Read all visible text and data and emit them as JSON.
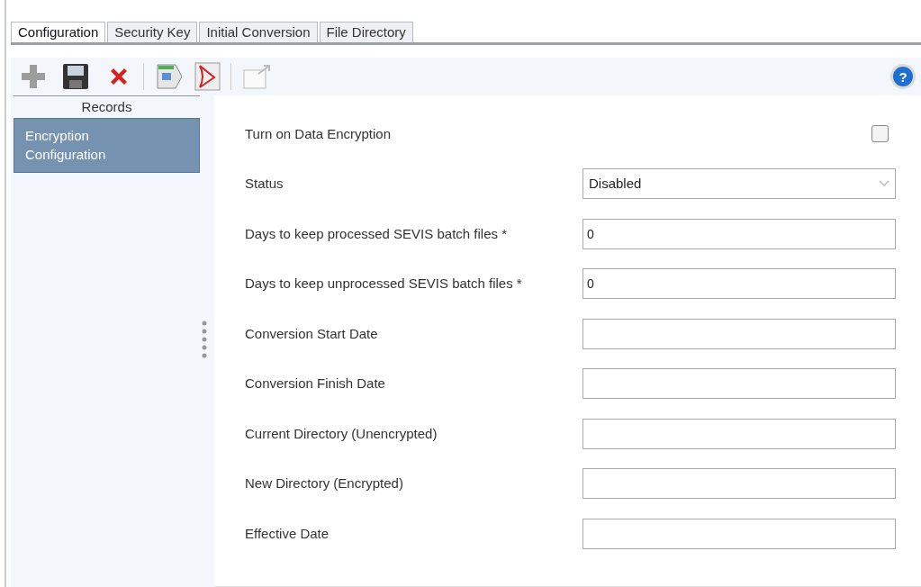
{
  "tabs": [
    {
      "label": "Configuration",
      "selected": true
    },
    {
      "label": "Security Key",
      "selected": false
    },
    {
      "label": "Initial Conversion",
      "selected": false
    },
    {
      "label": "File Directory",
      "selected": false
    }
  ],
  "help": {
    "label": "?"
  },
  "sidebar": {
    "title": "Records",
    "items": [
      {
        "label": "Encryption Configuration",
        "selected": true
      }
    ]
  },
  "form": {
    "fields": [
      {
        "kind": "checkbox",
        "label": "Turn on Data Encryption",
        "checked": false
      },
      {
        "kind": "select",
        "label": "Status",
        "value": "Disabled"
      },
      {
        "kind": "input",
        "label": "Days to keep processed SEVIS batch files *",
        "value": "0"
      },
      {
        "kind": "input",
        "label": "Days to keep unprocessed SEVIS batch files *",
        "value": "0"
      },
      {
        "kind": "input",
        "label": "Conversion Start Date"
      },
      {
        "kind": "input",
        "label": "Conversion Finish Date"
      },
      {
        "kind": "input",
        "label": "Current Directory (Unencrypted)"
      },
      {
        "kind": "input",
        "label": "New Directory (Encrypted)"
      },
      {
        "kind": "input",
        "label": "Effective Date"
      }
    ]
  }
}
